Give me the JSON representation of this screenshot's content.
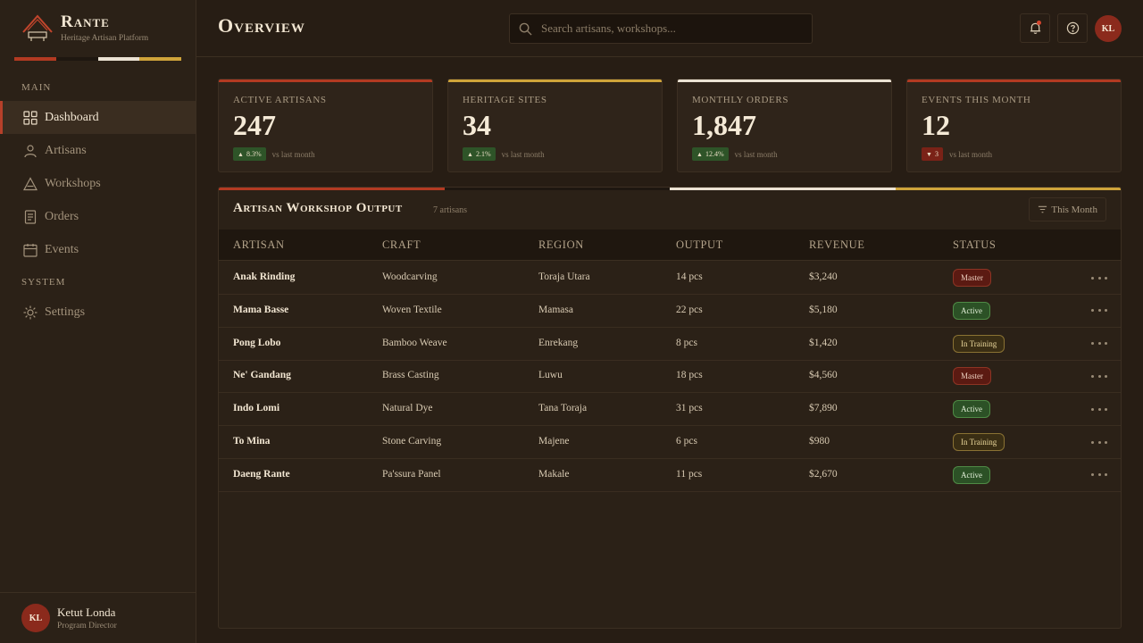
{
  "brand": {
    "name": "Rante",
    "subtitle": "Heritage Artisan Platform",
    "stripe_colors": [
      "#b33a22",
      "#1e1710",
      "#ebe2d3",
      "#cfa43a"
    ]
  },
  "sidebar": {
    "sections": [
      {
        "label": "MAIN"
      },
      {
        "label": "SYSTEM"
      }
    ],
    "items": [
      {
        "label": "Dashboard",
        "icon": "grid-icon",
        "active": true
      },
      {
        "label": "Artisans",
        "icon": "user-icon",
        "active": false
      },
      {
        "label": "Workshops",
        "icon": "triangle-house-icon",
        "active": false
      },
      {
        "label": "Orders",
        "icon": "document-icon",
        "active": false
      },
      {
        "label": "Events",
        "icon": "calendar-icon",
        "active": false
      },
      {
        "label": "Settings",
        "icon": "sun-gear-icon",
        "active": false
      }
    ],
    "user": {
      "initials": "KL",
      "name": "Ketut Londa",
      "role": "Program Director"
    }
  },
  "header": {
    "title": "Overview",
    "search_placeholder": "Search artisans, workshops...",
    "avatar_initials": "KL"
  },
  "stats": [
    {
      "label": "ACTIVE ARTISANS",
      "value": "247",
      "delta": "8.3%",
      "direction": "up",
      "note": "vs last month",
      "accent": "#b33a22"
    },
    {
      "label": "HERITAGE SITES",
      "value": "34",
      "delta": "2.1%",
      "direction": "up",
      "note": "vs last month",
      "accent": "#cfa43a"
    },
    {
      "label": "MONTHLY ORDERS",
      "value": "1,847",
      "delta": "12.4%",
      "direction": "up",
      "note": "vs last month",
      "accent": "#ebe2d3"
    },
    {
      "label": "EVENTS THIS MONTH",
      "value": "12",
      "delta": "3",
      "direction": "down",
      "note": "vs last month",
      "accent": "#b33a22"
    }
  ],
  "table": {
    "title": "Artisan Workshop Output",
    "count": "7 artisans",
    "filter_label": "This Month",
    "columns": [
      "ARTISAN",
      "CRAFT",
      "REGION",
      "OUTPUT",
      "REVENUE",
      "STATUS"
    ],
    "rows": [
      {
        "artisan": "Anak Rinding",
        "craft": "Woodcarving",
        "region": "Toraja Utara",
        "output": "14 pcs",
        "revenue": "$3,240",
        "status": "Master",
        "status_type": "master"
      },
      {
        "artisan": "Mama Basse",
        "craft": "Woven Textile",
        "region": "Mamasa",
        "output": "22 pcs",
        "revenue": "$5,180",
        "status": "Active",
        "status_type": "active"
      },
      {
        "artisan": "Pong Lobo",
        "craft": "Bamboo Weave",
        "region": "Enrekang",
        "output": "8 pcs",
        "revenue": "$1,420",
        "status": "In Training",
        "status_type": "training"
      },
      {
        "artisan": "Ne' Gandang",
        "craft": "Brass Casting",
        "region": "Luwu",
        "output": "18 pcs",
        "revenue": "$4,560",
        "status": "Master",
        "status_type": "master"
      },
      {
        "artisan": "Indo Lomi",
        "craft": "Natural Dye",
        "region": "Tana Toraja",
        "output": "31 pcs",
        "revenue": "$7,890",
        "status": "Active",
        "status_type": "active"
      },
      {
        "artisan": "To Mina",
        "craft": "Stone Carving",
        "region": "Majene",
        "output": "6 pcs",
        "revenue": "$980",
        "status": "In Training",
        "status_type": "training"
      },
      {
        "artisan": "Daeng Rante",
        "craft": "Pa'ssura Panel",
        "region": "Makale",
        "output": "11 pcs",
        "revenue": "$2,670",
        "status": "Active",
        "status_type": "active"
      }
    ]
  }
}
